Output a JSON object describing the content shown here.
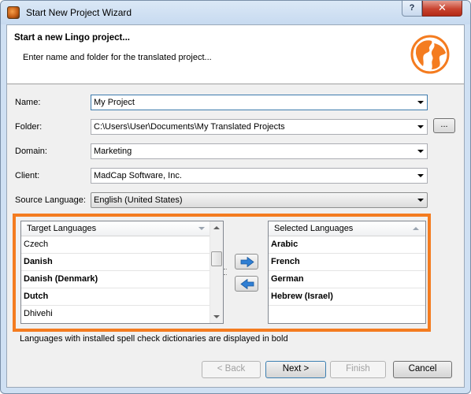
{
  "window": {
    "title": "Start New Project Wizard",
    "help_label": "?",
    "close_label": "✕"
  },
  "header": {
    "title": "Start a new Lingo project...",
    "subtitle": "Enter name and folder for the translated project..."
  },
  "form": {
    "name": {
      "label": "Name:",
      "value": "My Project"
    },
    "folder": {
      "label": "Folder:",
      "value": "C:\\Users\\User\\Documents\\My Translated Projects",
      "browse_label": "..."
    },
    "domain": {
      "label": "Domain:",
      "value": "Marketing"
    },
    "client": {
      "label": "Client:",
      "value": "MadCap Software, Inc."
    },
    "source_language": {
      "label": "Source Language:",
      "value": "English (United States)"
    }
  },
  "target_list": {
    "header": "Target Languages",
    "items": [
      {
        "label": "Czech",
        "bold": false
      },
      {
        "label": "Danish",
        "bold": true
      },
      {
        "label": "Danish (Denmark)",
        "bold": true
      },
      {
        "label": "Dutch",
        "bold": true
      },
      {
        "label": "Dhivehi",
        "bold": false
      }
    ]
  },
  "selected_list": {
    "header": "Selected Languages",
    "items": [
      {
        "label": "Arabic",
        "bold": true
      },
      {
        "label": "French",
        "bold": true
      },
      {
        "label": "German",
        "bold": true
      },
      {
        "label": "Hebrew (Israel)",
        "bold": true
      }
    ]
  },
  "note": "Languages with installed spell check dictionaries are displayed in bold",
  "buttons": {
    "back": "< Back",
    "next": "Next >",
    "finish": "Finish",
    "cancel": "Cancel"
  },
  "colors": {
    "highlight": "#f47c20",
    "move_arrow": "#2f7fd4",
    "globe": "#f47c20"
  }
}
